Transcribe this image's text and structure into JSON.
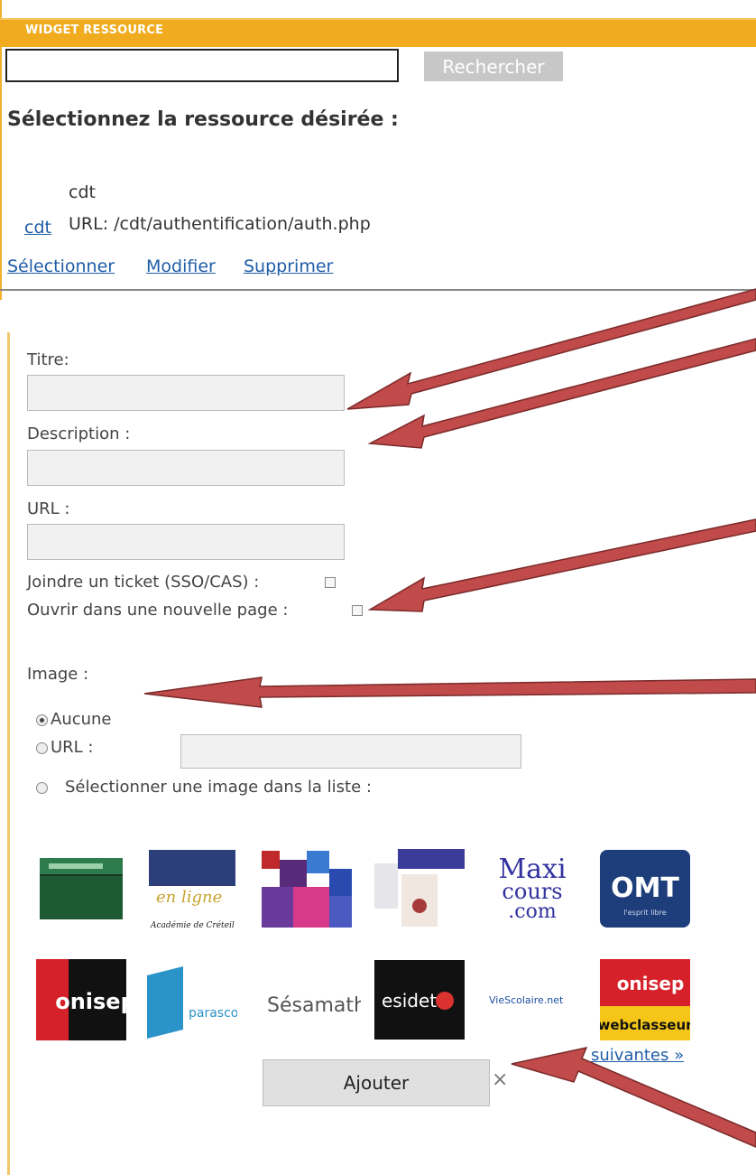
{
  "widget": {
    "title": "WIDGET RESSOURCE",
    "search": {
      "value": "",
      "button": "Rechercher"
    },
    "heading": "Sélectionnez la ressource désirée :",
    "resource": {
      "link": "cdt",
      "name": "cdt",
      "url": "URL: /cdt/authentification/auth.php"
    },
    "actions": [
      "Sélectionner",
      "Modifier",
      "Supprimer"
    ]
  },
  "form": {
    "title_label": "Titre:",
    "title_value": "",
    "description_label": "Description :",
    "description_value": "",
    "url_label": "URL :",
    "url_value": "",
    "ticket_label": "Joindre un ticket (SSO/CAS) :",
    "ticket_checked": false,
    "newpage_label": "Ouvrir dans une nouvelle page :",
    "newpage_checked": false,
    "image_label": "Image :",
    "image_options": {
      "none": "Aucune",
      "url": "URL :",
      "list": "Sélectionner une image dans la liste :"
    },
    "image_selected": "none",
    "image_url_value": "",
    "next_link": "suivantes »",
    "submit": "Ajouter",
    "close": "×"
  },
  "thumbnails": {
    "maxi": [
      "Maxi",
      "cours",
      ".com"
    ],
    "omt": "OMT",
    "omt_sub": "l'esprit libre",
    "capitale": "Académie de Créteil",
    "onisep": "onisep",
    "sesamath": "Sésamath",
    "esidetv": "esidetv",
    "viescolaire": "VieScolaire.net",
    "onisep2": "onisep",
    "webclasseur": "webclasseur",
    "parasco": "parasco"
  },
  "colors": {
    "accent": "#f0ab1e",
    "link": "#1f5da6",
    "arrow": "#c14a4a"
  }
}
